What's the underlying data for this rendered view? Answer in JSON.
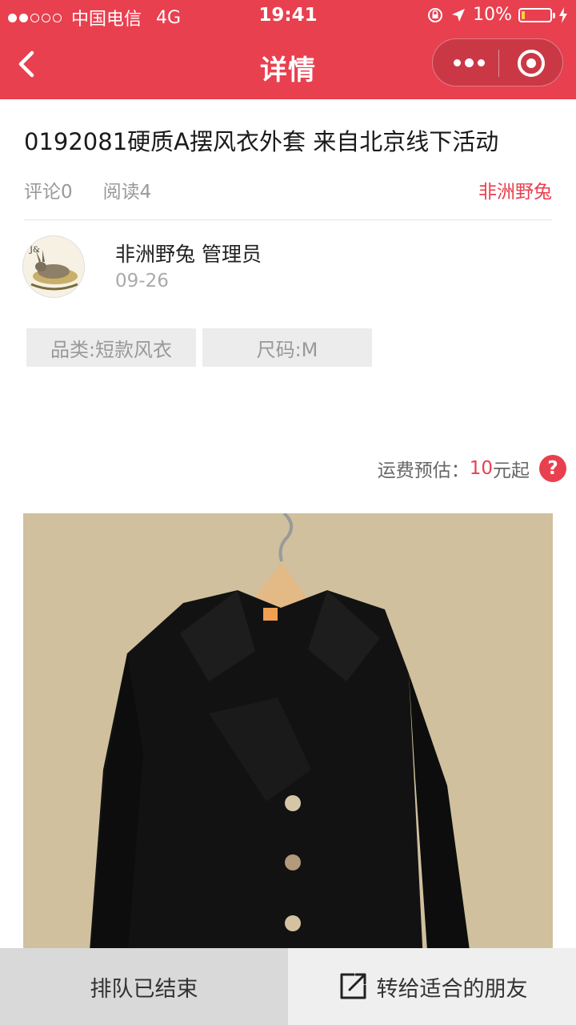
{
  "status_bar": {
    "carrier": "中国电信",
    "network": "4G",
    "time": "19:41",
    "battery": "10%"
  },
  "nav": {
    "title": "详情"
  },
  "post": {
    "title": "0192081硬质A摆风衣外套 来自北京线下活动",
    "comments": "评论0",
    "reads": "阅读4",
    "author_link": "非洲野兔"
  },
  "poster": {
    "name": "非洲野兔 管理员",
    "date": "09-26"
  },
  "tags": [
    {
      "label": "品类:短款风衣"
    },
    {
      "label": "尺码:M"
    }
  ],
  "shipping": {
    "label": "运费预估：",
    "price": "10",
    "suffix": "元起",
    "help": "?"
  },
  "bottom": {
    "ended_label": "排队已结束",
    "share_label": "转给适合的朋友"
  },
  "colors": {
    "brand_red": "#e8404f",
    "grey_text": "#999999"
  },
  "icons": {
    "back": "chevron-left-icon",
    "more": "more-dots-icon",
    "close": "target-close-icon",
    "help": "question-icon",
    "share": "share-external-icon"
  }
}
